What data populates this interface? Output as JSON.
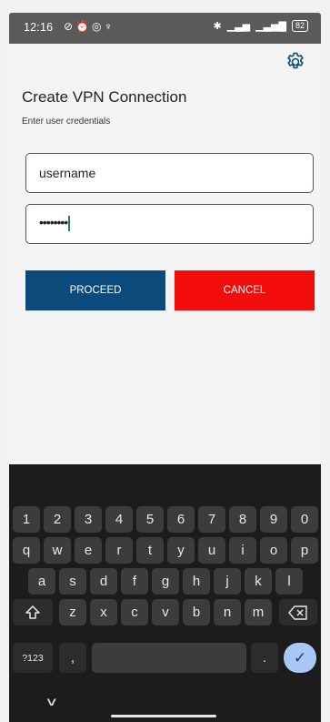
{
  "status_bar": {
    "time": "12:16",
    "left_icons": [
      "bell-off-icon",
      "alarm-icon",
      "whatsapp-icon",
      "trophy-icon"
    ],
    "right_icons": [
      "bluetooth-icon",
      "signal-icon",
      "4g-signal-icon",
      "battery-icon"
    ],
    "battery_level": "82"
  },
  "app": {
    "settings_icon": "gear-icon",
    "title": "Create VPN Connection",
    "subtitle": "Enter user credentials",
    "username_value": "username",
    "password_value": "••••••••",
    "proceed_label": "PROCEED",
    "cancel_label": "CANCEL",
    "colors": {
      "proceed": "#0b4a7a",
      "cancel": "#f20c0c"
    }
  },
  "keyboard": {
    "row_numbers": [
      "1",
      "2",
      "3",
      "4",
      "5",
      "6",
      "7",
      "8",
      "9",
      "0"
    ],
    "row_q": [
      "q",
      "w",
      "e",
      "r",
      "t",
      "y",
      "u",
      "i",
      "o",
      "p"
    ],
    "row_a": [
      "a",
      "s",
      "d",
      "f",
      "g",
      "h",
      "j",
      "k",
      "l"
    ],
    "row_z": [
      "z",
      "x",
      "c",
      "v",
      "b",
      "n",
      "m"
    ],
    "symbols_label": "?123",
    "comma": ",",
    "period": ".",
    "shift_icon": "shift-icon",
    "backspace_icon": "backspace-icon",
    "enter_icon": "check-icon"
  },
  "nav": {
    "hide_keyboard_icon": "chevron-down-icon"
  }
}
